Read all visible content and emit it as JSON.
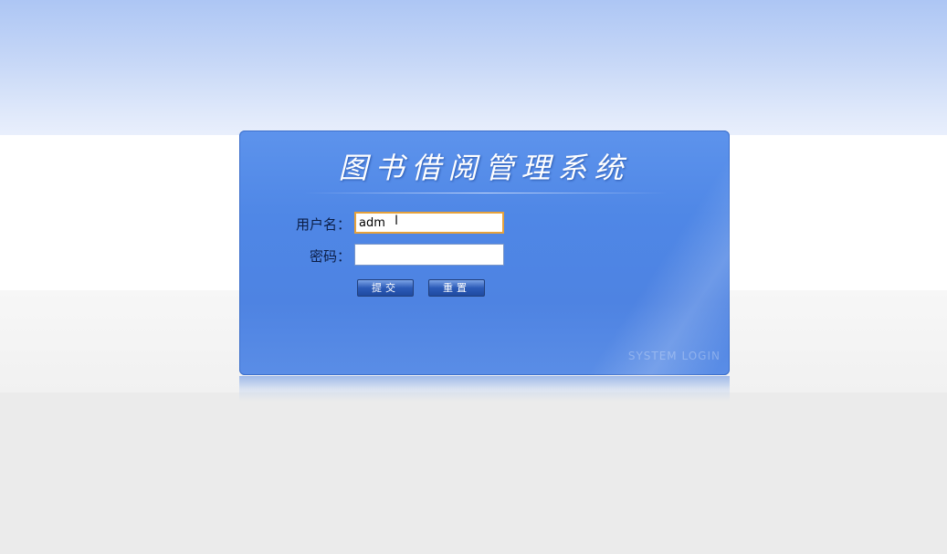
{
  "app": {
    "title": "图书借阅管理系统"
  },
  "login_form": {
    "username_label": "用户名：",
    "username_value": "adm",
    "password_label": "密码：",
    "password_value": "",
    "submit_label": "提交",
    "reset_label": "重置",
    "watermark": "SYSTEM LOGIN"
  },
  "colors": {
    "panel": "#4f87e6",
    "focus_border": "#e6a23c",
    "header_band": "#adc6f4"
  }
}
